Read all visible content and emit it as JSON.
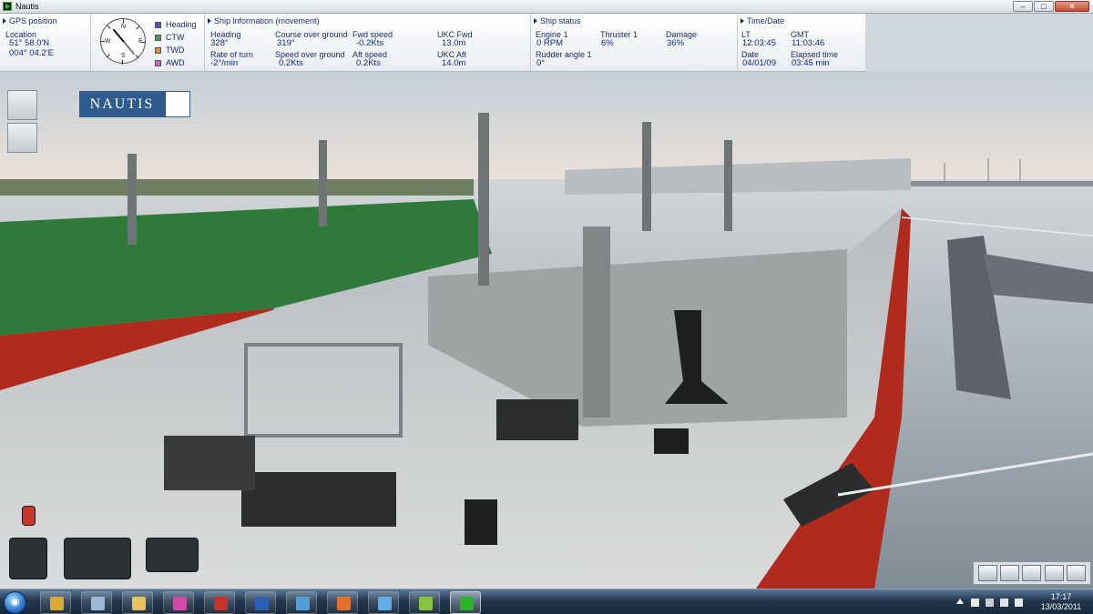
{
  "window": {
    "title": "Nautis",
    "controls": {
      "minimize": "–",
      "maximize": "□",
      "close": "✕"
    }
  },
  "hud": {
    "gps": {
      "title": "GPS position",
      "location_label": "Location",
      "lat": "51° 58.0'N",
      "lon": "004° 04.2'E"
    },
    "compass": {
      "letters": {
        "n": "N",
        "e": "E",
        "s": "S",
        "w": "W"
      },
      "legend": [
        {
          "label": "Heading",
          "color": "#5a4fd1"
        },
        {
          "label": "CTW",
          "color": "#3aa24a"
        },
        {
          "label": "TWD",
          "color": "#e88a2e"
        },
        {
          "label": "AWD",
          "color": "#d656c8"
        }
      ]
    },
    "ship_info": {
      "title": "Ship information (movement)",
      "heading_label": "Heading",
      "heading": "328°",
      "cog_label": "Course over ground",
      "cog": "319°",
      "fwd_speed_label": "Fwd speed",
      "fwd_speed": "-0.2Kts",
      "ukc_fwd_label": "UKC Fwd",
      "ukc_fwd": "13.0m",
      "rot_label": "Rate of turn",
      "rot": "-2°/min",
      "sog_label": "Speed over ground",
      "sog": "0.2Kts",
      "aft_speed_label": "Aft speed",
      "aft_speed": "0.2Kts",
      "ukc_aft_label": "UKC Aft",
      "ukc_aft": "14.0m"
    },
    "ship_status": {
      "title": "Ship status",
      "engine_label": "Engine 1",
      "engine": "0 RPM",
      "thruster_label": "Thruster 1",
      "thruster": "6%",
      "damage_label": "Damage",
      "damage": "36%",
      "rudder_label": "Rudder angle 1",
      "rudder": "0°"
    },
    "time": {
      "title": "Time/Date",
      "lt_label": "LT",
      "lt": "12:03:45",
      "gmt_label": "GMT",
      "gmt": "11:03:46",
      "date_label": "Date",
      "date": "04/01/09",
      "elapsed_label": "Elapsed time",
      "elapsed": "03:45 min"
    }
  },
  "scene": {
    "logo": "NAUTIS",
    "colors": {
      "sky_top": "#c4cfd8",
      "sky_horizon": "#eee2d8",
      "water": "#9aa8b2",
      "deck": "#c9ccce",
      "hull_red": "#b02a1e",
      "green_deck": "#2f7a3a"
    }
  },
  "taskbar": {
    "start_glyph": "◉",
    "apps": [
      {
        "icon": "crest-icon",
        "color": "#d9a934"
      },
      {
        "icon": "calculator-icon",
        "color": "#9fb8d4"
      },
      {
        "icon": "folder-icon",
        "color": "#e8c25a"
      },
      {
        "icon": "paint-icon",
        "color": "#d04aa8"
      },
      {
        "icon": "pdf-icon",
        "color": "#c7332b"
      },
      {
        "icon": "word-icon",
        "color": "#2b5fb4"
      },
      {
        "icon": "messenger-icon",
        "color": "#4f9fd9"
      },
      {
        "icon": "firefox-icon",
        "color": "#e2702a"
      },
      {
        "icon": "notes-icon",
        "color": "#5fb0e6"
      },
      {
        "icon": "network-icon",
        "color": "#8bc43f"
      },
      {
        "icon": "nautis-icon",
        "color": "#2ab42a"
      }
    ],
    "clock": {
      "time": "17:17",
      "date": "13/03/2011"
    }
  }
}
